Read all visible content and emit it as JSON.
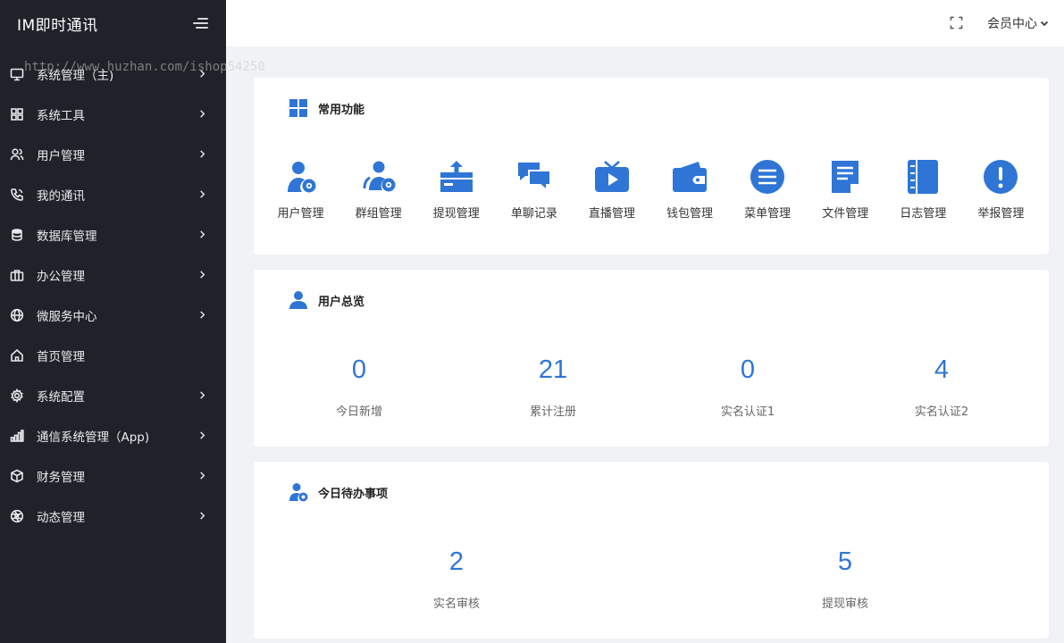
{
  "app": {
    "title": "IM即时通讯"
  },
  "watermark": "http://www.huzhan.com/ishop54250",
  "sidebar": {
    "items": [
      {
        "label": "系统管理（主)",
        "icon": "monitor-icon",
        "has_arrow": true
      },
      {
        "label": "系统工具",
        "icon": "grid-icon",
        "has_arrow": true
      },
      {
        "label": "用户管理",
        "icon": "users-icon",
        "has_arrow": true
      },
      {
        "label": "我的通讯",
        "icon": "phone-icon",
        "has_arrow": true
      },
      {
        "label": "数据库管理",
        "icon": "database-icon",
        "has_arrow": true
      },
      {
        "label": "办公管理",
        "icon": "briefcase-icon",
        "has_arrow": true
      },
      {
        "label": "微服务中心",
        "icon": "globe-icon",
        "has_arrow": true
      },
      {
        "label": "首页管理",
        "icon": "home-icon",
        "has_arrow": false
      },
      {
        "label": "系统配置",
        "icon": "gear-icon",
        "has_arrow": true
      },
      {
        "label": "通信系统管理（App)",
        "icon": "bar-chart-icon",
        "has_arrow": true
      },
      {
        "label": "财务管理",
        "icon": "box-icon",
        "has_arrow": true
      },
      {
        "label": "动态管理",
        "icon": "aperture-icon",
        "has_arrow": true
      }
    ]
  },
  "header": {
    "member_center": "会员中心"
  },
  "functions": {
    "title": "常用功能",
    "items": [
      {
        "label": "用户管理",
        "icon": "user-gear-icon"
      },
      {
        "label": "群组管理",
        "icon": "group-gear-icon"
      },
      {
        "label": "提现管理",
        "icon": "withdraw-icon"
      },
      {
        "label": "单聊记录",
        "icon": "chat-bubbles-icon"
      },
      {
        "label": "直播管理",
        "icon": "tv-play-icon"
      },
      {
        "label": "钱包管理",
        "icon": "wallet-icon"
      },
      {
        "label": "菜单管理",
        "icon": "menu-list-icon"
      },
      {
        "label": "文件管理",
        "icon": "document-icon"
      },
      {
        "label": "日志管理",
        "icon": "notebook-icon"
      },
      {
        "label": "举报管理",
        "icon": "alert-icon"
      }
    ]
  },
  "user_overview": {
    "title": "用户总览",
    "stats": [
      {
        "value": "0",
        "label": "今日新增"
      },
      {
        "value": "21",
        "label": "累计注册"
      },
      {
        "value": "0",
        "label": "实名认证1"
      },
      {
        "value": "4",
        "label": "实名认证2"
      }
    ]
  },
  "todo": {
    "title": "今日待办事项",
    "stats": [
      {
        "value": "2",
        "label": "实名审核"
      },
      {
        "value": "5",
        "label": "提现审核"
      }
    ]
  },
  "colors": {
    "sidebar_bg": "#1f2229",
    "accent": "#2f75d6",
    "page_bg": "#f0f2f5"
  }
}
